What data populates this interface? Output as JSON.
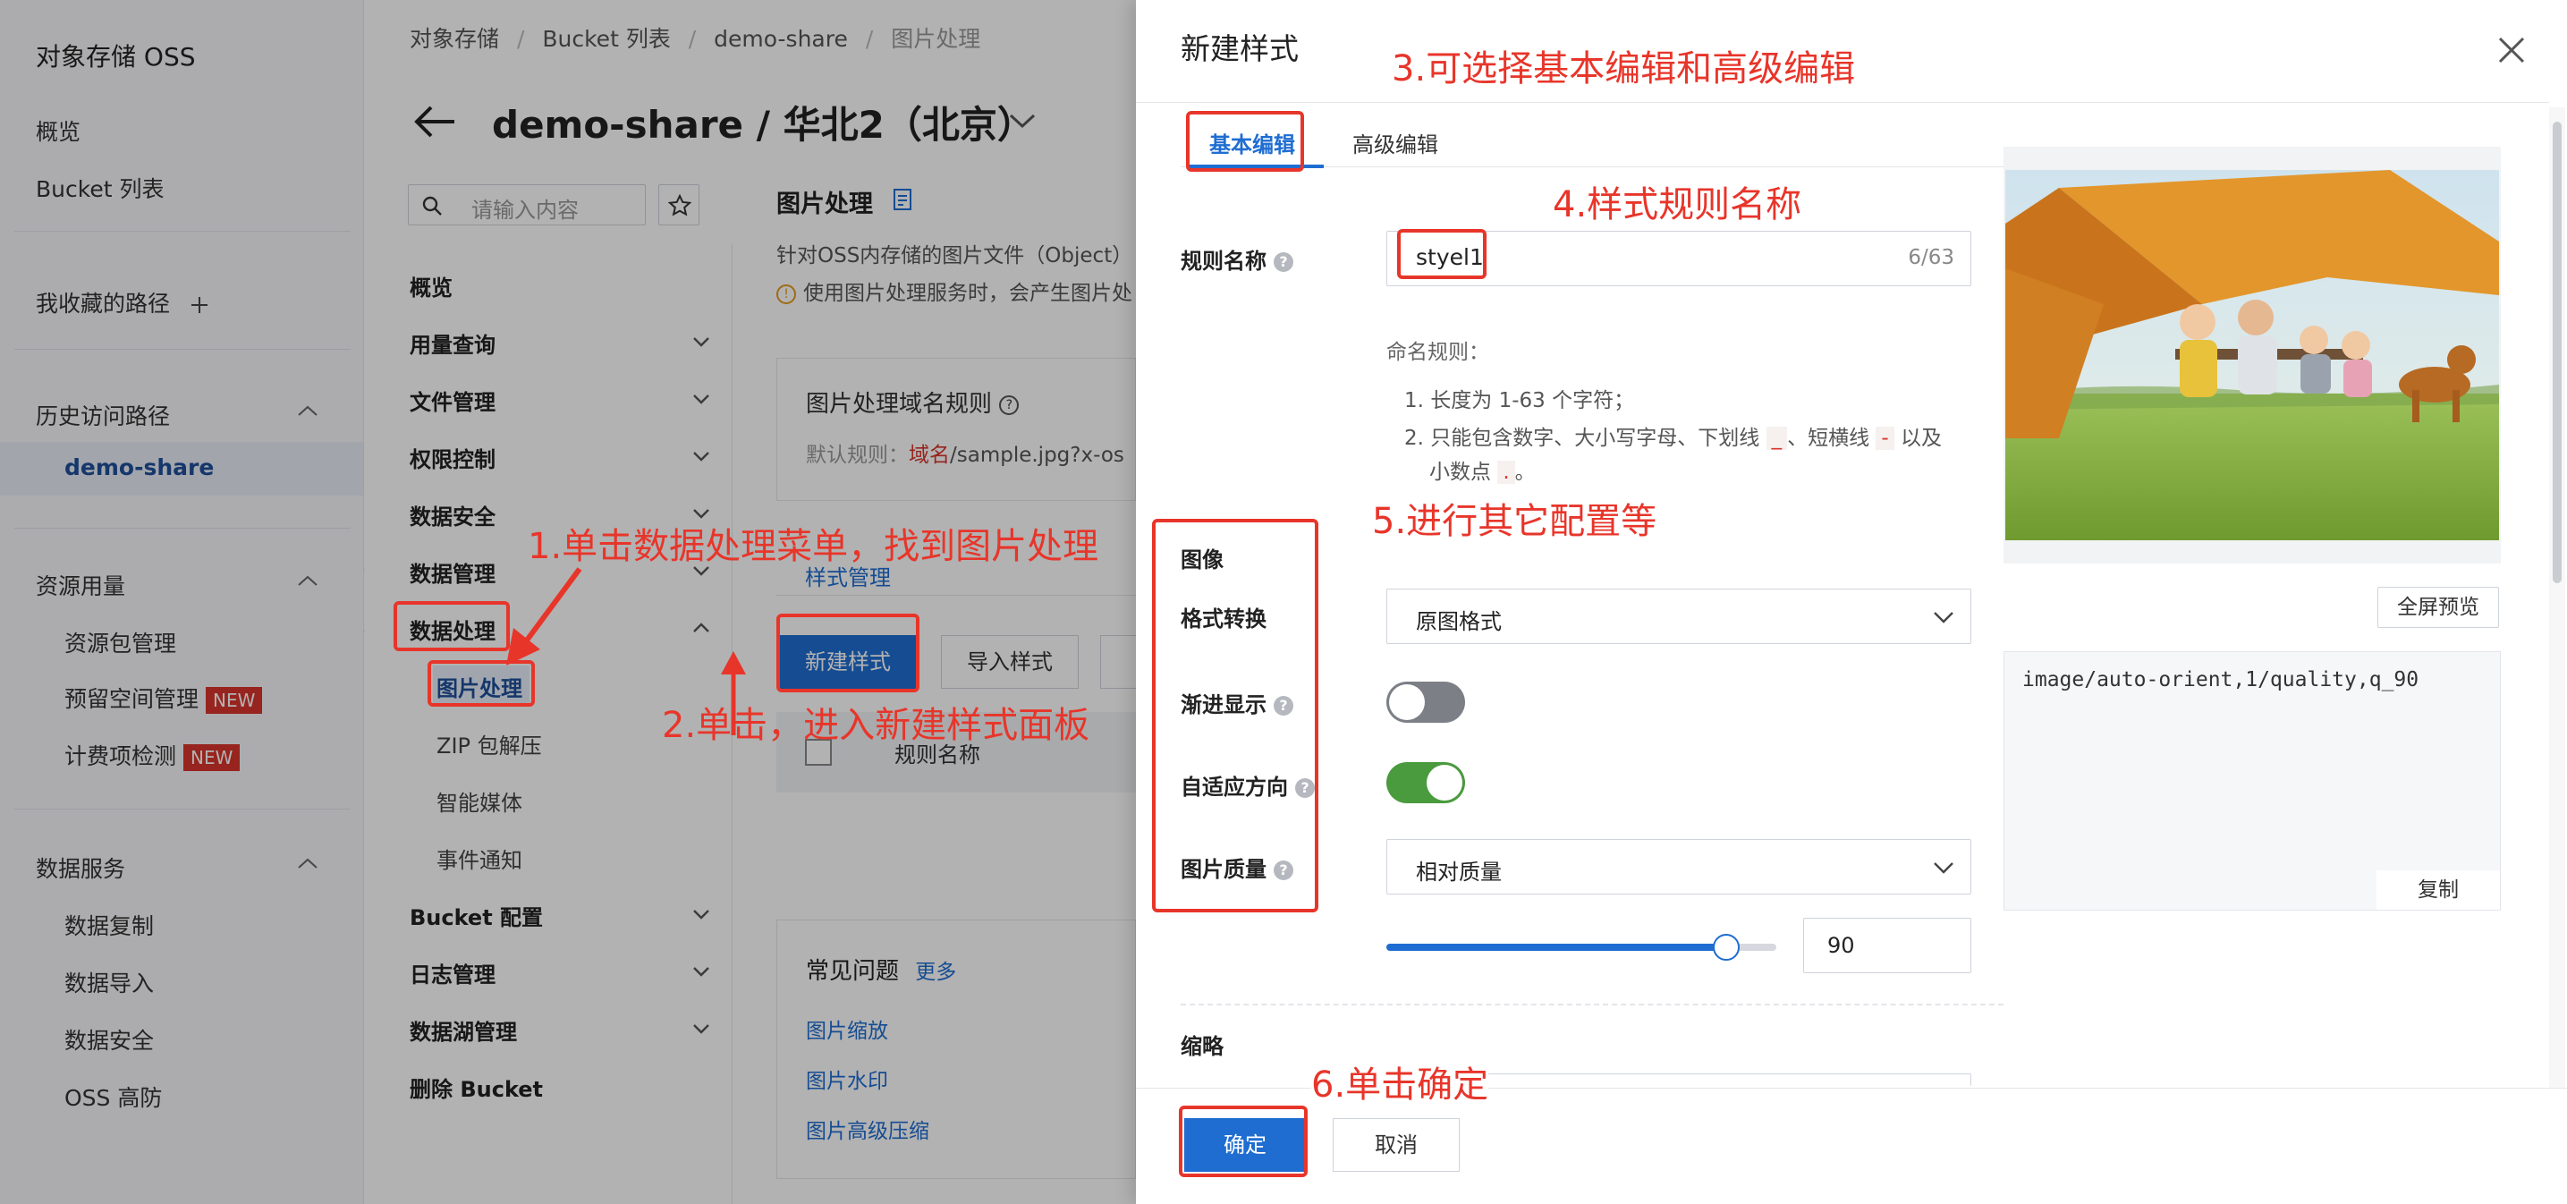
{
  "left_nav": {
    "title": "对象存储 OSS",
    "overview": "概览",
    "bucket_list": "Bucket 列表",
    "favorites": "我收藏的路径",
    "history": "历史访问路径",
    "history_item": "demo-share",
    "resource_usage": "资源用量",
    "resource_items": [
      {
        "label": "资源包管理",
        "badge": ""
      },
      {
        "label": "预留空间管理",
        "badge": "NEW"
      },
      {
        "label": "计费项检测",
        "badge": "NEW"
      }
    ],
    "data_services": "数据服务",
    "data_items": [
      "数据复制",
      "数据导入",
      "数据安全",
      "OSS 高防"
    ]
  },
  "breadcrumb": [
    "对象存储",
    "Bucket 列表",
    "demo-share",
    "图片处理"
  ],
  "page_title": "demo-share / 华北2（北京）",
  "search_placeholder": "请输入内容",
  "mid_menu": {
    "items": [
      {
        "label": "概览",
        "chevron": false
      },
      {
        "label": "用量查询",
        "chevron": true
      },
      {
        "label": "文件管理",
        "chevron": true
      },
      {
        "label": "权限控制",
        "chevron": true
      },
      {
        "label": "数据安全",
        "chevron": true
      },
      {
        "label": "数据管理",
        "chevron": true
      },
      {
        "label": "数据处理",
        "chevron": true
      }
    ],
    "sub_items": [
      "图片处理",
      "ZIP 包解压",
      "智能媒体",
      "事件通知"
    ],
    "bottom_items": [
      {
        "label": "Bucket 配置",
        "chevron": true
      },
      {
        "label": "日志管理",
        "chevron": true
      },
      {
        "label": "数据湖管理",
        "chevron": true
      },
      {
        "label": "删除 Bucket",
        "chevron": false
      }
    ]
  },
  "content": {
    "section_title": "图片处理",
    "desc": "针对OSS内存储的图片文件（Object）",
    "warning": "使用图片处理服务时，会产生图片处",
    "domain_rule_title": "图片处理域名规则",
    "domain_rule_prefix": "默认规则：",
    "domain_rule_domain": "域名",
    "domain_rule_rest": "/sample.jpg?x-os",
    "tab_style_manage": "样式管理",
    "btn_new_style": "新建样式",
    "btn_import_style": "导入样式",
    "table_col_rule_name": "规则名称",
    "faq_title": "常见问题",
    "faq_more": "更多",
    "faq_items": [
      "图片缩放",
      "图片水印",
      "图片高级压缩"
    ]
  },
  "drawer": {
    "title": "新建样式",
    "tabs": [
      "基本编辑",
      "高级编辑"
    ],
    "rule_name_label": "规则名称",
    "rule_name_value": "styel1",
    "rule_name_count": "6/63",
    "naming_rules_title": "命名规则：",
    "naming_rule_1": "1. 长度为 1-63 个字符；",
    "naming_rule_2a": "2. 只能包含数字、大小写字母、下划线",
    "naming_rule_2_underscore": "_",
    "naming_rule_2b": "、短横线",
    "naming_rule_2_dash": "-",
    "naming_rule_2c": "以及",
    "naming_rule_2d": "小数点",
    "naming_rule_2_dot": ".",
    "naming_rule_2e": "。",
    "section_image": "图像",
    "format_label": "格式转换",
    "format_value": "原图格式",
    "progressive_label": "渐进显示",
    "progressive_on": false,
    "auto_orient_label": "自适应方向",
    "auto_orient_on": true,
    "quality_label": "图片质量",
    "quality_value": "相对质量",
    "quality_slider_value": 90,
    "quality_input": "90",
    "section_thumb": "缩略",
    "fullscreen_preview": "全屏预览",
    "code": "image/auto-orient,1/quality,q_90",
    "copy": "复制",
    "ok": "确定",
    "cancel": "取消"
  },
  "annotations": {
    "a1": "1.单击数据处理菜单，找到图片处理",
    "a2": "2.单击，进入新建样式面板",
    "a3": "3.可选择基本编辑和高级编辑",
    "a4": "4.样式规则名称",
    "a5": "5.进行其它配置等",
    "a6": "6.单击确定"
  },
  "colors": {
    "primary": "#1f6dd1",
    "annotation": "#e8352a",
    "toggle_on": "#4a9a3e",
    "new_badge": "#d9342b"
  }
}
